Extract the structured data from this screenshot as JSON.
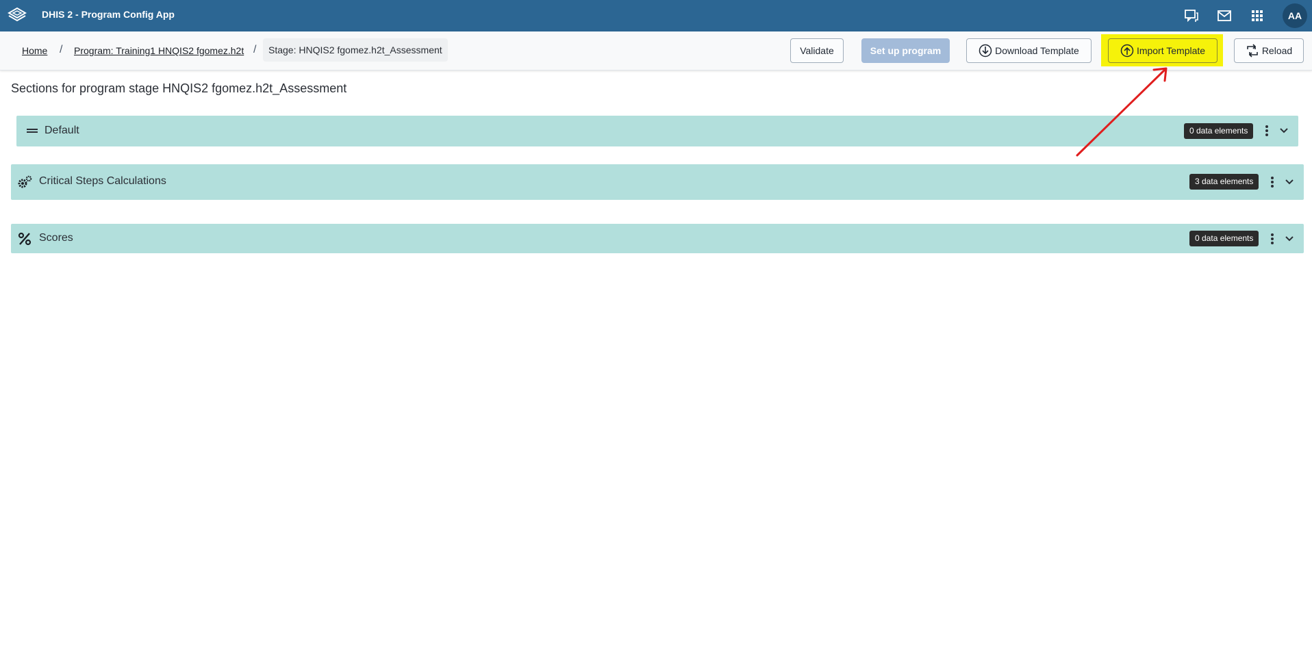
{
  "header": {
    "app_title": "DHIS 2 - Program Config App",
    "avatar_initials": "AA",
    "icons": [
      "logo-icon",
      "interpretations-icon",
      "messages-icon",
      "apps-grid-icon"
    ]
  },
  "breadcrumb": {
    "home": "Home",
    "program": "Program: Training1 HNQIS2 fgomez.h2t",
    "stage": "Stage: HNQIS2 fgomez.h2t_Assessment",
    "separator": "/"
  },
  "toolbar": {
    "validate": "Validate",
    "setup": "Set up program",
    "download": "Download Template",
    "import": "Import Template",
    "reload": "Reload"
  },
  "page": {
    "title": "Sections for program stage HNQIS2 fgomez.h2t_Assessment"
  },
  "sections": [
    {
      "title": "Default",
      "badge": "0 data elements",
      "icon": "drag-handle-icon"
    },
    {
      "title": "Critical Steps Calculations",
      "badge": "3 data elements",
      "icon": "gears-icon"
    },
    {
      "title": "Scores",
      "badge": "0 data elements",
      "icon": "percent-icon"
    }
  ],
  "colors": {
    "header": "#2c6693",
    "section": "#b2dfdc",
    "highlight": "#f6f20a",
    "annotation_arrow": "#e01e1e"
  }
}
